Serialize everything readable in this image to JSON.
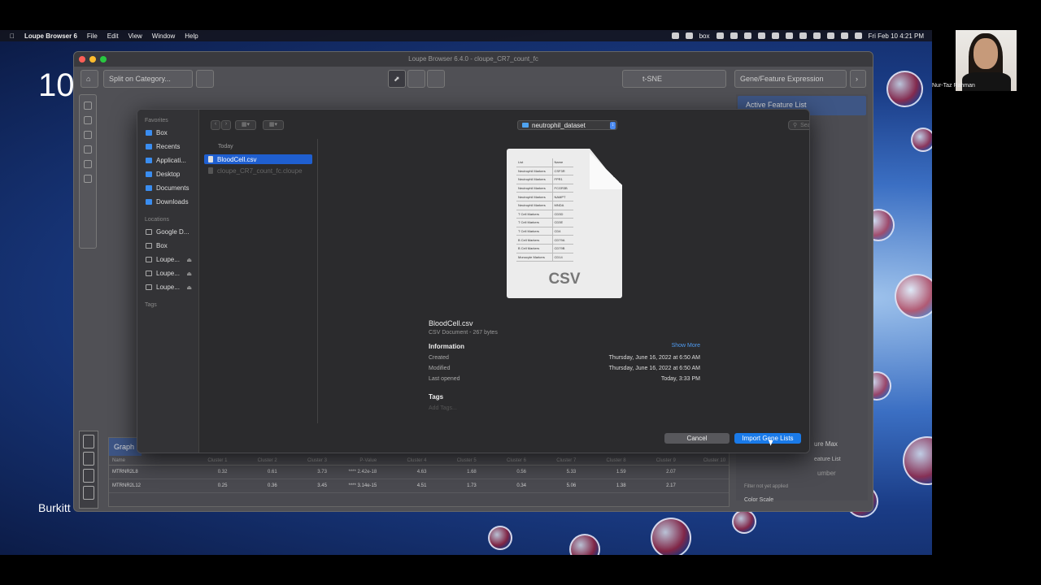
{
  "menubar": {
    "app": "Loupe Browser 6",
    "items": [
      "File",
      "Edit",
      "View",
      "Window",
      "Help"
    ],
    "clock": "Fri Feb 10  4:21 PM",
    "box_label": "box"
  },
  "slide": {
    "big_text": "10",
    "bottom_text": "Burkitt"
  },
  "window": {
    "title": "Loupe Browser 6.4.0 - cloupe_CR7_count_fc",
    "split_label": "Split on Category...",
    "projection": "t-SNE",
    "mode": "Gene/Feature Expression",
    "active_list": "Active Feature List",
    "color_scale": "Color Scale",
    "feature_max": "ure Max",
    "feature_list": "eature List",
    "number": "umber",
    "filter_note": "Filter not yet applied"
  },
  "table": {
    "title": "Graph",
    "columns": [
      "Name",
      "Cluster 1",
      "Cluster 2",
      "Cluster 3",
      "P-Value",
      "Cluster 4",
      "Cluster 5",
      "Cluster 6",
      "Cluster 7",
      "Cluster 8",
      "Cluster 9",
      "Cluster 10"
    ],
    "rows": [
      [
        "MTRNR2L8",
        "0.32",
        "0.61",
        "3.73",
        "**** 2.42e-18",
        "4.63",
        "1.68",
        "0.56",
        "5.33",
        "1.59",
        "2.07",
        ""
      ],
      [
        "MTRNR2L12",
        "0.25",
        "0.36",
        "3.45",
        "**** 3.14e-15",
        "4.51",
        "1.73",
        "0.34",
        "5.06",
        "1.38",
        "2.17",
        ""
      ]
    ]
  },
  "dialog": {
    "favorites_label": "Favorites",
    "favorites": [
      "Box",
      "Recents",
      "Applicati...",
      "Desktop",
      "Documents",
      "Downloads"
    ],
    "locations_label": "Locations",
    "locations": [
      "Google D...",
      "Box",
      "Loupe...",
      "Loupe...",
      "Loupe..."
    ],
    "tags_label": "Tags",
    "folder": "neutrophil_dataset",
    "search_placeholder": "Search",
    "group_label": "Today",
    "files": [
      "BloodCell.csv",
      "cloupe_CR7_count_fc.cloupe"
    ],
    "preview": {
      "icon_text": "CSV",
      "table": [
        [
          "List",
          "Name"
        ],
        [
          "Neutrophil Markers",
          "CSF3R"
        ],
        [
          "Neutrophil Markers",
          "FPR1"
        ],
        [
          "Neutrophil Markers",
          "FCGR3B"
        ],
        [
          "Neutrophil Markers",
          "NAMPT"
        ],
        [
          "Neutrophil Markers",
          "MNDA"
        ],
        [
          "T Cell Markers",
          "CD3D"
        ],
        [
          "T Cell Markers",
          "CD3E"
        ],
        [
          "T Cell Markers",
          "CD4"
        ],
        [
          "B Cell Markers",
          "CD79A"
        ],
        [
          "B Cell Markers",
          "CD79B"
        ],
        [
          "Monocyte Markers",
          "CD14"
        ]
      ]
    },
    "info": {
      "name": "BloodCell.csv",
      "type": "CSV Document - 267 bytes",
      "section": "Information",
      "show_more": "Show More",
      "created_label": "Created",
      "created": "Thursday, June 16, 2022 at 6:50 AM",
      "modified_label": "Modified",
      "modified": "Thursday, June 16, 2022 at 6:50 AM",
      "opened_label": "Last opened",
      "opened": "Today, 3:33 PM",
      "tags_label": "Tags",
      "add_tags": "Add Tags..."
    },
    "cancel": "Cancel",
    "import": "Import Gene Lists"
  },
  "webcam": {
    "name": "Nur-Taz Rahman"
  },
  "colors": {
    "accent": "#1a7ae8",
    "selection": "#1f5fd0"
  }
}
